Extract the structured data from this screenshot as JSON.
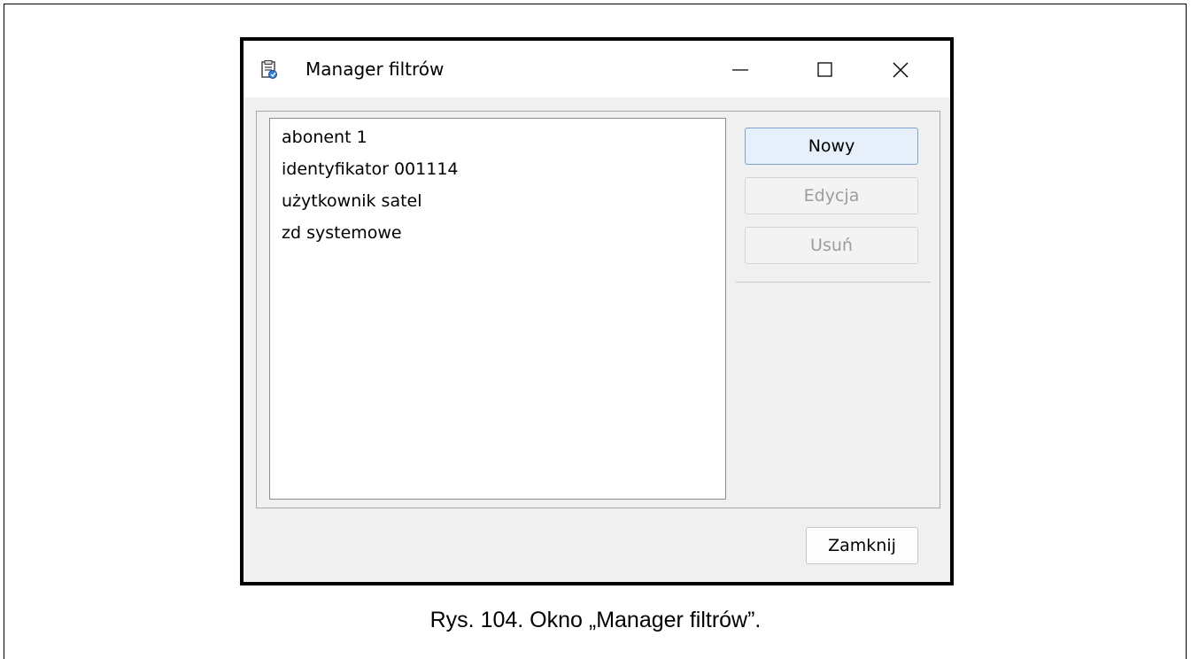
{
  "window": {
    "title": "Manager filtrów",
    "icons": {
      "app": "filter-manager-app-icon",
      "minimize": "minimize-icon",
      "maximize": "maximize-icon",
      "close": "close-icon"
    }
  },
  "list": {
    "items": [
      "abonent 1",
      "identyfikator 001114",
      "użytkownik satel",
      "zd systemowe"
    ]
  },
  "buttons": {
    "new_label": "Nowy",
    "edit_label": "Edycja",
    "delete_label": "Usuń",
    "close_label": "Zamknij"
  },
  "caption": "Rys. 104. Okno „Manager filtrów”.",
  "colors": {
    "window_bg": "#f0f0f0",
    "titlebar_bg": "#ffffff",
    "default_button_bg": "#e7f0fa",
    "default_button_border": "#7ea4cd",
    "disabled_text": "#9c9c9c"
  }
}
